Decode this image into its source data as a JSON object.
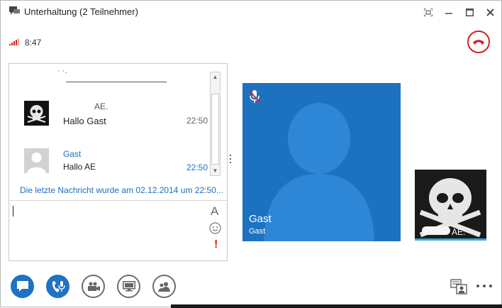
{
  "window": {
    "title": "Unterhaltung (2 Teilnehmer)",
    "controls": [
      "fullscreen",
      "minimize",
      "maximize",
      "close"
    ]
  },
  "status": {
    "time": "8:47",
    "signal_color": "#d4221c"
  },
  "chat": {
    "history_fragment": "· ·.",
    "messages": [
      {
        "sender": "AE.",
        "text": "Hallo Gast",
        "time": "22:50",
        "avatar": "skull-avatar",
        "highlight": false
      },
      {
        "sender": "Gast",
        "text": "Hallo AE",
        "time": "22:50",
        "avatar": "default-person-avatar",
        "highlight": true
      }
    ],
    "last_message_notice": "Die letzte Nachricht wurde am 02.12.2014 um 22:50...",
    "compose_value": "",
    "font_button": "A",
    "priority_button": "!"
  },
  "video": {
    "main": {
      "name": "Gast",
      "sub": "Gast",
      "muted": true,
      "bg_color": "#1d72c0"
    },
    "self": {
      "name": "AE."
    }
  },
  "toolbar": {
    "buttons": [
      {
        "name": "im-button",
        "icon": "chat-bubble-icon",
        "active": true
      },
      {
        "name": "audio-button",
        "icon": "phone-mic-icon",
        "active": true
      },
      {
        "name": "video-button",
        "icon": "camera-icon",
        "active": false
      },
      {
        "name": "present-button",
        "icon": "monitor-icon",
        "active": false
      },
      {
        "name": "participants-button",
        "icon": "people-icon",
        "active": false
      }
    ]
  },
  "colors": {
    "accent": "#1f72c4",
    "link": "#1f6fbf",
    "hangup": "#d4221c"
  }
}
